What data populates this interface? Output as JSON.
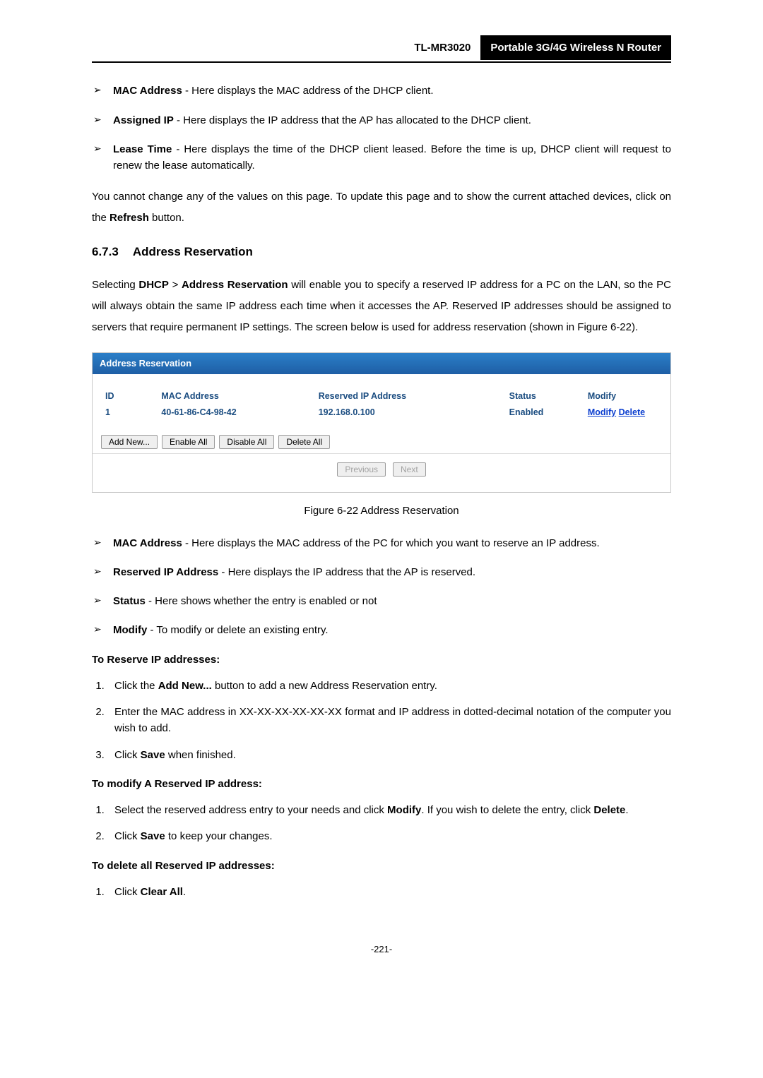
{
  "header": {
    "model": "TL-MR3020",
    "product": "Portable 3G/4G Wireless N Router"
  },
  "top_bullets": [
    {
      "term": "MAC Address",
      "text": " - Here displays the MAC address of the DHCP client."
    },
    {
      "term": "Assigned IP",
      "text": " - Here displays the IP address that the AP has allocated to the DHCP client."
    },
    {
      "term": "Lease Time",
      "text": " - Here displays the time of the DHCP client leased. Before the time is up, DHCP client will request to renew the lease automatically."
    }
  ],
  "paragraph_refresh_a": "You cannot change any of the values on this page. To update this page and to show the current attached devices, click on the ",
  "paragraph_refresh_bold": "Refresh",
  "paragraph_refresh_b": " button.",
  "section": {
    "num": "6.7.3",
    "title": "Address Reservation"
  },
  "intro_a": "Selecting ",
  "intro_dhcp": "DHCP",
  "intro_gt": " > ",
  "intro_ar": "Address Reservation",
  "intro_b": " will enable you to specify a reserved IP address for a PC on the LAN, so the PC will always obtain the same IP address each time when it accesses the AP. Reserved IP addresses should be assigned to servers that require permanent IP settings. The screen below is used for address reservation (shown in Figure 6-22).",
  "figure": {
    "titlebar": "Address Reservation",
    "headers": {
      "id": "ID",
      "mac": "MAC Address",
      "ip": "Reserved IP Address",
      "status": "Status",
      "modify": "Modify"
    },
    "row": {
      "id": "1",
      "mac": "40-61-86-C4-98-42",
      "ip": "192.168.0.100",
      "status": "Enabled",
      "modify": "Modify",
      "delete": "Delete"
    },
    "buttons": {
      "add": "Add New...",
      "enable": "Enable All",
      "disable": "Disable All",
      "deleteall": "Delete All",
      "prev": "Previous",
      "next": "Next"
    }
  },
  "caption": "Figure 6-22 Address Reservation",
  "def_bullets": [
    {
      "term": "MAC Address",
      "text": " - Here displays the MAC address of the PC for which you want to reserve an IP address."
    },
    {
      "term": "Reserved IP Address",
      "text": " - Here displays the IP address that the AP is reserved."
    },
    {
      "term": "Status",
      "text": " - Here shows whether the entry is enabled or not"
    },
    {
      "term": "Modify",
      "text": " - To modify or delete an existing entry."
    }
  ],
  "h_reserve": "To Reserve IP addresses:",
  "steps_reserve": [
    {
      "pre": "Click the ",
      "bold": "Add New...",
      "post": " button to add a new Address Reservation entry."
    },
    {
      "pre": "Enter the MAC address in XX-XX-XX-XX-XX-XX format and IP address in dotted-decimal notation of the computer you wish to add.",
      "bold": "",
      "post": ""
    },
    {
      "pre": "Click ",
      "bold": "Save",
      "post": " when finished."
    }
  ],
  "h_modify": "To modify A Reserved IP address:",
  "steps_modify": [
    {
      "pre": "Select the reserved address entry to your needs and click ",
      "bold": "Modify",
      "post": ". If you wish to delete the entry, click ",
      "bold2": "Delete",
      "post2": "."
    },
    {
      "pre": "Click ",
      "bold": "Save",
      "post": " to keep your changes."
    }
  ],
  "h_delete": "To delete all Reserved IP addresses:",
  "steps_delete": [
    {
      "pre": "Click ",
      "bold": "Clear All",
      "post": "."
    }
  ],
  "pagenum": "-221-"
}
